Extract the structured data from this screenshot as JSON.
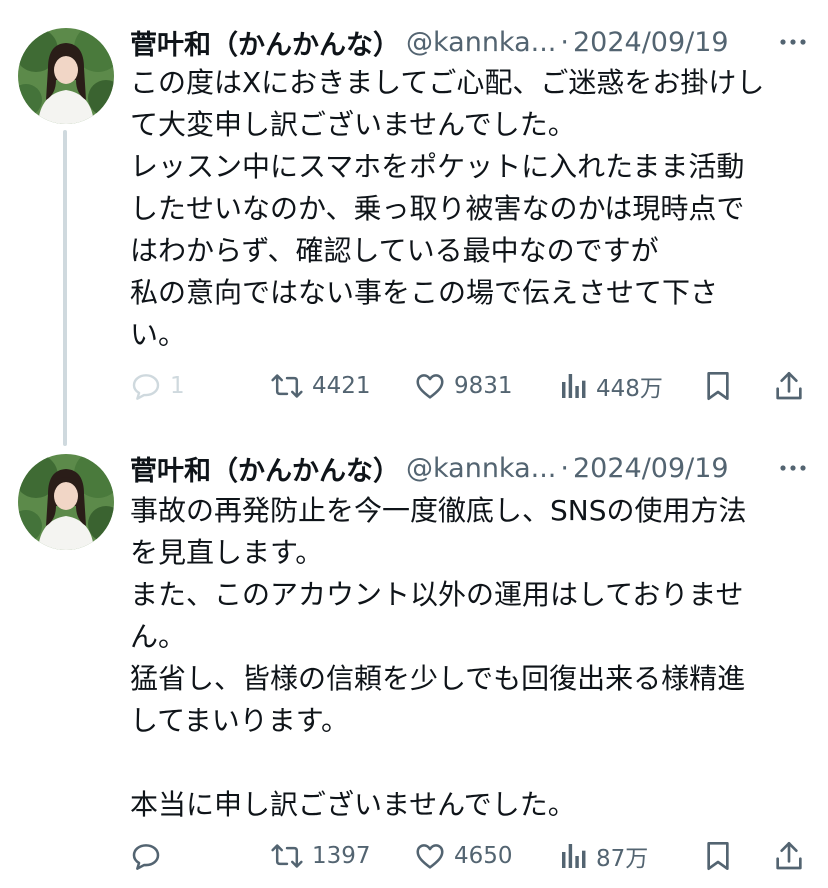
{
  "tweets": [
    {
      "display_name": "菅叶和（かんかんな）",
      "handle": "@kannka...",
      "separator": "·",
      "date": "2024/09/19",
      "body_lines": [
        "この度はXにおきましてご心配、ご迷惑をお掛けし",
        "て大変申し訳ございませんでした。",
        "レッスン中にスマホをポケットに入れたまま活動",
        "したせいなのか、乗っ取り被害なのかは現時点で",
        "はわからず、確認している最中なのですが",
        "私の意向ではない事をこの場で伝えさせて下さ",
        "い。"
      ],
      "replies": "1",
      "reposts": "4421",
      "likes": "9831",
      "views": "448万"
    },
    {
      "display_name": "菅叶和（かんかんな）",
      "handle": "@kannka...",
      "separator": "·",
      "date": "2024/09/19",
      "body_lines": [
        "事故の再発防止を今一度徹底し、SNSの使用方法",
        "を見直します。",
        "また、このアカウント以外の運用はしておりませ",
        "ん。",
        "猛省し、皆様の信頼を少しでも回復出来る様精進",
        "してまいります。",
        "",
        "本当に申し訳ございませんでした。"
      ],
      "reposts": "1397",
      "likes": "4650",
      "views": "87万"
    }
  ],
  "colors": {
    "text": "#0f1419",
    "secondary": "#536471",
    "thread_line": "#cfd9de",
    "background": "#ffffff"
  },
  "icons": {
    "avatar": "profile-photo",
    "more": "more-dots-icon",
    "reply": "reply-bubble-icon",
    "repost": "repost-arrows-icon",
    "like": "heart-icon",
    "views": "views-bars-icon",
    "bookmark": "bookmark-icon",
    "share": "share-upload-icon"
  }
}
